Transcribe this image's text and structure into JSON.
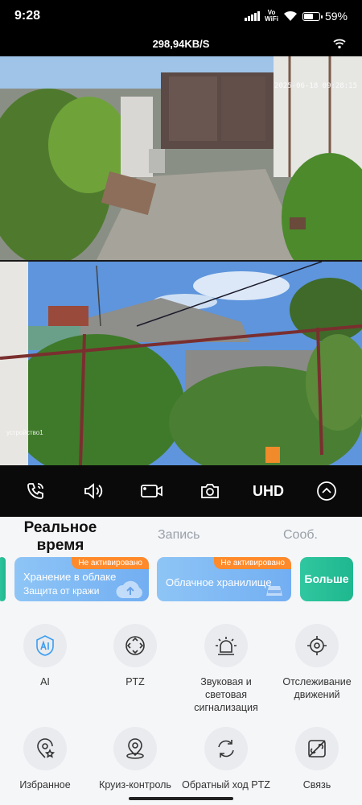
{
  "status_bar": {
    "time": "9:28",
    "vowifi_top": "Vo",
    "vowifi_bottom": "WiFi",
    "battery": "59%",
    "battery_level": 0.59
  },
  "stream": {
    "speed": "298,94KB/S"
  },
  "cameras": [
    {
      "timestamp": "2025-06-18 09:28:15",
      "label": ""
    },
    {
      "timestamp": "",
      "label": "устройство1"
    }
  ],
  "controls": {
    "call_icon": "phone-call-icon",
    "sound_icon": "speaker-icon",
    "record_icon": "video-camera-icon",
    "snapshot_icon": "photo-camera-icon",
    "quality_label": "UHD",
    "expand_icon": "chevron-up-icon"
  },
  "tabs": [
    {
      "label": "Реальное время",
      "active": true
    },
    {
      "label": "Запись",
      "active": false
    },
    {
      "label": "Сооб.",
      "active": false
    }
  ],
  "service_cards": [
    {
      "badge": "Не активировано",
      "title": "Хранение в облаке",
      "subtitle": "Защита от кражи"
    },
    {
      "badge": "Не активировано",
      "title": "Облачное хранилище"
    },
    {
      "title": "Больше"
    }
  ],
  "features": [
    {
      "label": "AI",
      "icon": "ai-icon"
    },
    {
      "label": "PTZ",
      "icon": "ptz-icon"
    },
    {
      "label": "Звуковая и световая сигнализация",
      "icon": "siren-light-icon"
    },
    {
      "label": "Отслеживание движений",
      "icon": "motion-tracking-icon"
    },
    {
      "label": "Избранное",
      "icon": "favorite-location-icon"
    },
    {
      "label": "Круиз-контроль",
      "icon": "cruise-location-icon"
    },
    {
      "label": "Обратный ход PTZ",
      "icon": "ptz-return-icon"
    },
    {
      "label": "Связь",
      "icon": "link-icon"
    }
  ],
  "colors": {
    "accent_orange": "#ff8a2b",
    "card_blue": "#72aef2",
    "card_green": "#1fb78e"
  }
}
